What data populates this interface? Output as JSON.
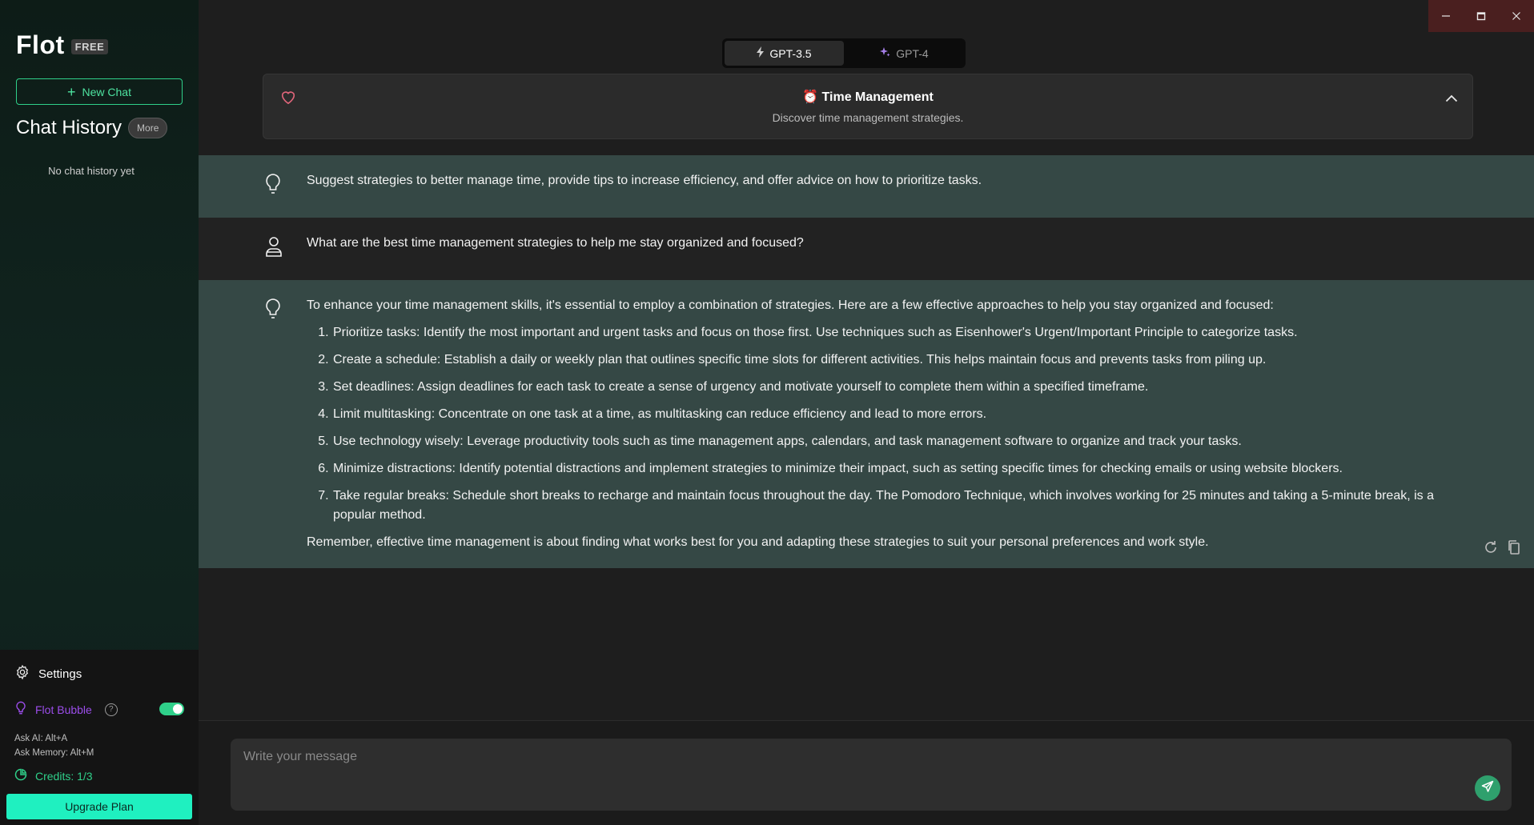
{
  "app": {
    "name": "Flot",
    "badge": "FREE"
  },
  "sidebar": {
    "new_chat_label": "New Chat",
    "history_title": "Chat History",
    "more_label": "More",
    "empty_history": "No chat history yet",
    "settings_label": "Settings",
    "bubble_label": "Flot Bubble",
    "bubble_enabled": true,
    "shortcut_ask_ai": "Ask AI: Alt+A",
    "shortcut_ask_memory": "Ask Memory: Alt+M",
    "credits_label": "Credits: 1/3",
    "upgrade_label": "Upgrade Plan"
  },
  "models": {
    "options": [
      {
        "label": "GPT-3.5",
        "icon": "bolt-icon",
        "active": true
      },
      {
        "label": "GPT-4",
        "icon": "sparkle-icon",
        "active": false
      }
    ]
  },
  "prompt_card": {
    "emoji": "⏰",
    "title": "Time Management",
    "subtitle": "Discover time management strategies."
  },
  "messages": {
    "system_prompt": "Suggest strategies to better manage time, provide tips to increase efficiency, and offer advice on how to prioritize tasks.",
    "user_question": "What are the best time management strategies to help me stay organized and focused?",
    "answer_intro": "To enhance your time management skills, it's essential to employ a combination of strategies. Here are a few effective approaches to help you stay organized and focused:",
    "answer_items": [
      "Prioritize tasks: Identify the most important and urgent tasks and focus on those first. Use techniques such as Eisenhower's Urgent/Important Principle to categorize tasks.",
      "Create a schedule: Establish a daily or weekly plan that outlines specific time slots for different activities. This helps maintain focus and prevents tasks from piling up.",
      "Set deadlines: Assign deadlines for each task to create a sense of urgency and motivate yourself to complete them within a specified timeframe.",
      "Limit multitasking: Concentrate on one task at a time, as multitasking can reduce efficiency and lead to more errors.",
      "Use technology wisely: Leverage productivity tools such as time management apps, calendars, and task management software to organize and track your tasks.",
      "Minimize distractions: Identify potential distractions and implement strategies to minimize their impact, such as setting specific times for checking emails or using website blockers.",
      "Take regular breaks: Schedule short breaks to recharge and maintain focus throughout the day. The Pomodoro Technique, which involves working for 25 minutes and taking a 5-minute break, is a popular method."
    ],
    "answer_outro": "Remember, effective time management is about finding what works best for you and adapting these strategies to suit your personal preferences and work style."
  },
  "input": {
    "placeholder": "Write your message"
  },
  "colors": {
    "accent": "#2fd08a",
    "upgrade": "#1ff0c0",
    "bubble": "#9b4dea",
    "ai_bg": "#354845"
  }
}
